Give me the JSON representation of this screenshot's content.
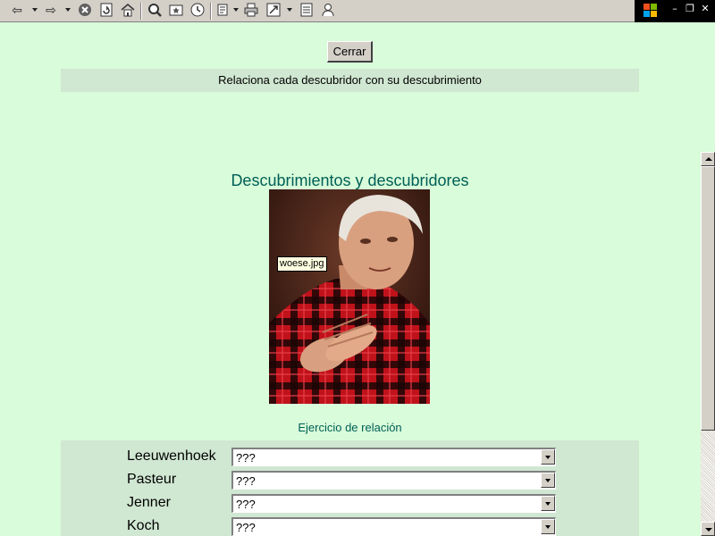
{
  "toolbar": {
    "icons": [
      "back-icon",
      "forward-icon",
      "stop-icon",
      "refresh-icon",
      "home-icon",
      "search-icon",
      "favorites-icon",
      "history-icon",
      "edit-icon",
      "print-icon",
      "fullscreen-icon",
      "page-icon",
      "user-icon"
    ]
  },
  "page": {
    "close_label": "Cerrar",
    "instruction": "Relaciona cada descubridor con su descubrimiento",
    "title": "Descubrimientos y descubridores",
    "image_tooltip": "woese.jpg",
    "exercise_label": "Ejercicio de relación"
  },
  "matching": {
    "rows": [
      {
        "label": "Leeuwenhoek",
        "selected": "???"
      },
      {
        "label": "Pasteur",
        "selected": "???"
      },
      {
        "label": "Jenner",
        "selected": "???"
      },
      {
        "label": "Koch",
        "selected": "???"
      }
    ]
  },
  "colors": {
    "page_bg": "#d9fcda",
    "panel_bg": "#d0e7d2",
    "heading": "#006057"
  }
}
